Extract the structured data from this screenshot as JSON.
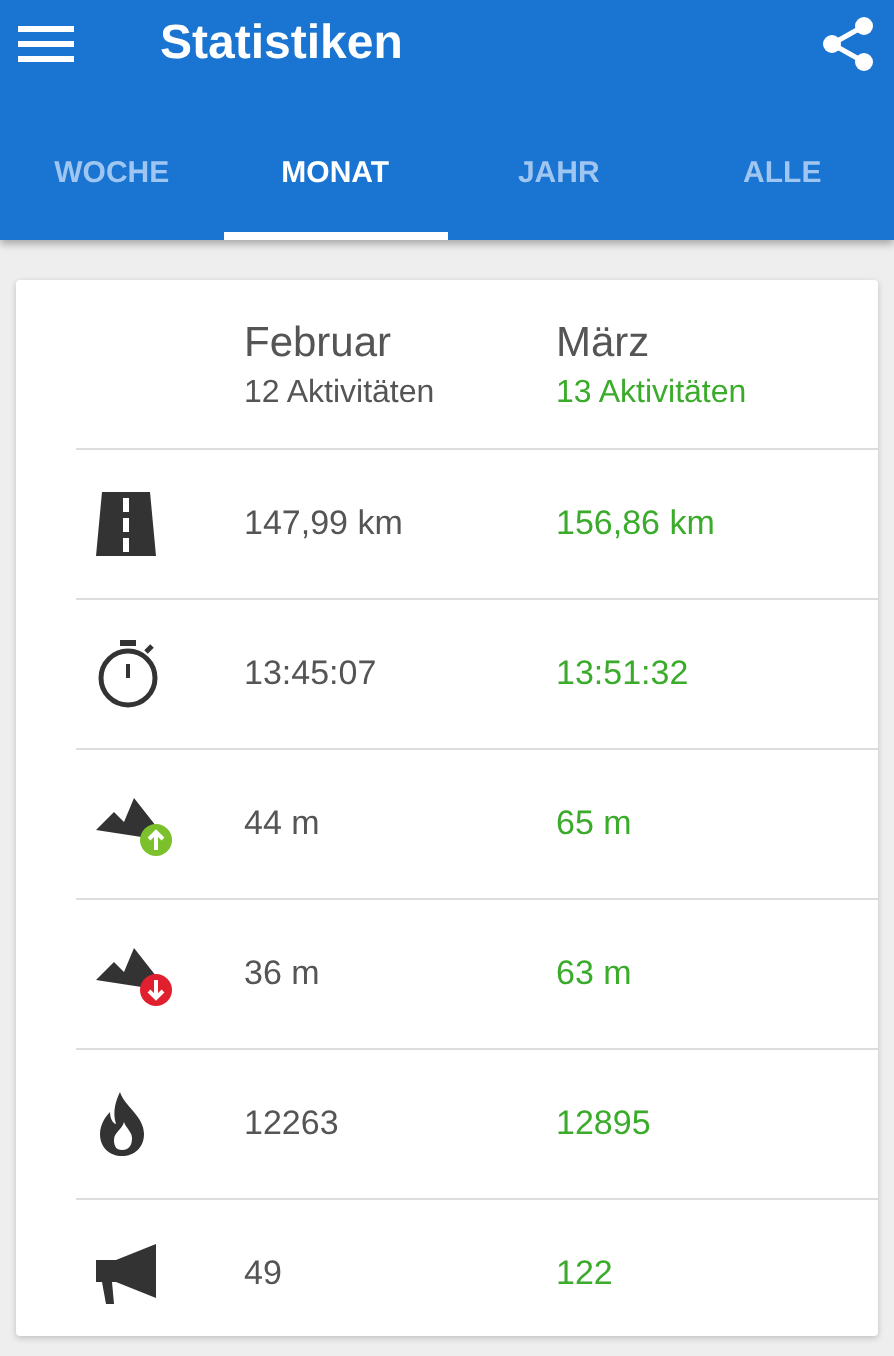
{
  "app_bar": {
    "title": "Statistiken"
  },
  "tabs": [
    {
      "label": "WOCHE",
      "selected": false
    },
    {
      "label": "MONAT",
      "selected": true
    },
    {
      "label": "JAHR",
      "selected": false
    },
    {
      "label": "ALLE",
      "selected": false
    }
  ],
  "columns": [
    {
      "month": "Februar",
      "activities": "12 Aktivitäten",
      "highlight": false
    },
    {
      "month": "März",
      "activities": "13 Aktivitäten",
      "highlight": true
    }
  ],
  "rows": [
    {
      "kind": "distance",
      "values": [
        "147,99 km",
        "156,86 km"
      ]
    },
    {
      "kind": "duration",
      "values": [
        "13:45:07",
        "13:51:32"
      ]
    },
    {
      "kind": "ascent",
      "values": [
        "44 m",
        "65 m"
      ]
    },
    {
      "kind": "descent",
      "values": [
        "36 m",
        "63 m"
      ]
    },
    {
      "kind": "calories",
      "values": [
        "12263",
        "12895"
      ]
    },
    {
      "kind": "count",
      "values": [
        "49",
        "122"
      ]
    }
  ]
}
